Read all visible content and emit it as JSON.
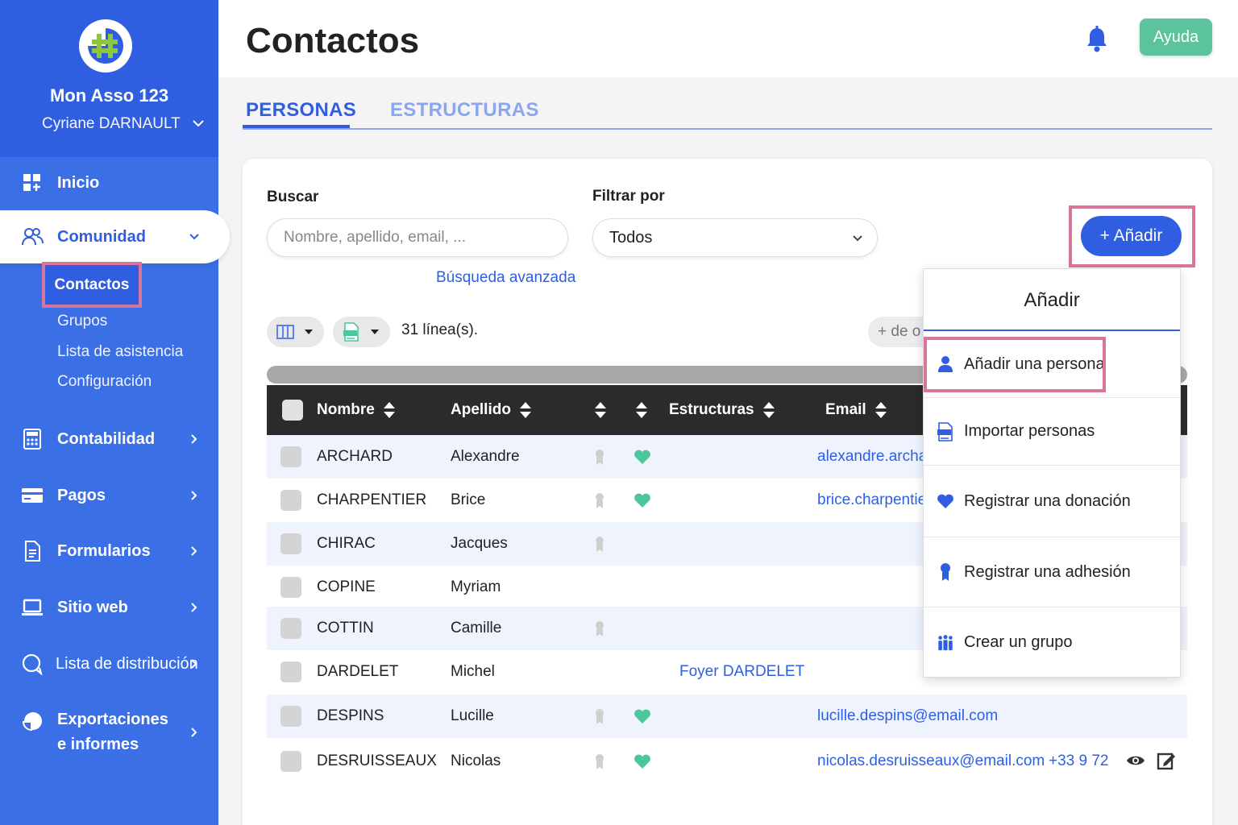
{
  "sidebar": {
    "org_name": "Mon Asso 123",
    "user_name": "Cyriane DARNAULT",
    "items": [
      {
        "label": "Inicio",
        "icon": "dashboard-icon"
      },
      {
        "label": "Comunidad",
        "icon": "community-icon"
      },
      {
        "label": "Contabilidad",
        "icon": "calculator-icon"
      },
      {
        "label": "Pagos",
        "icon": "credit-card-icon"
      },
      {
        "label": "Formularios",
        "icon": "form-icon"
      },
      {
        "label": "Sitio web",
        "icon": "laptop-icon"
      },
      {
        "label": "Lista de distribución",
        "icon": "chat-icon"
      },
      {
        "label": "Exportaciones e informes",
        "icon": "pie-chart-icon"
      }
    ],
    "sub_items": [
      "Contactos",
      "Grupos",
      "Lista de asistencia",
      "Configuración"
    ]
  },
  "header": {
    "title": "Contactos",
    "help_label": "Ayuda"
  },
  "tabs": [
    "PERSONAS",
    "ESTRUCTURAS"
  ],
  "filters": {
    "search_label": "Buscar",
    "search_placeholder": "Nombre, apellido, email, ...",
    "filter_label": "Filtrar por",
    "filter_value": "Todos",
    "advanced_search": "Búsqueda avanzada",
    "add_button": "+ Añadir"
  },
  "toolbar": {
    "lines_count": "31 línea(s).",
    "more_label": "+ de o"
  },
  "table": {
    "columns": [
      "Nombre",
      "Apellido",
      "",
      "",
      "Estructuras",
      "Email"
    ],
    "rows": [
      {
        "nombre": "ARCHARD",
        "apellido": "Alexandre",
        "membership": true,
        "donor": true,
        "estructura": "",
        "email": "alexandre.archard",
        "phone": ""
      },
      {
        "nombre": "CHARPENTIER",
        "apellido": "Brice",
        "membership": true,
        "donor": true,
        "estructura": "",
        "email": "brice.charpentier",
        "phone": ""
      },
      {
        "nombre": "CHIRAC",
        "apellido": "Jacques",
        "membership": true,
        "donor": false,
        "estructura": "",
        "email": "",
        "phone": ""
      },
      {
        "nombre": "COPINE",
        "apellido": "Myriam",
        "membership": false,
        "donor": false,
        "estructura": "",
        "email": "",
        "phone": ""
      },
      {
        "nombre": "COTTIN",
        "apellido": "Camille",
        "membership": true,
        "donor": false,
        "estructura": "",
        "email": "",
        "phone": ""
      },
      {
        "nombre": "DARDELET",
        "apellido": "Michel",
        "membership": false,
        "donor": false,
        "estructura": "Foyer DARDELET",
        "email": "",
        "phone": ""
      },
      {
        "nombre": "DESPINS",
        "apellido": "Lucille",
        "membership": true,
        "donor": true,
        "estructura": "",
        "email": "lucille.despins@email.com",
        "phone": ""
      },
      {
        "nombre": "DESRUISSEAUX",
        "apellido": "Nicolas",
        "membership": true,
        "donor": true,
        "estructura": "",
        "email": "nicolas.desruisseaux@email.com",
        "phone": "+33 9 72"
      }
    ]
  },
  "add_menu": {
    "title": "Añadir",
    "items": [
      {
        "label": "Añadir una persona",
        "icon": "person-icon"
      },
      {
        "label": "Importar personas",
        "icon": "spreadsheet-icon"
      },
      {
        "label": "Registrar una donación",
        "icon": "heart-icon"
      },
      {
        "label": "Registrar una adhesión",
        "icon": "ribbon-icon"
      },
      {
        "label": "Crear un grupo",
        "icon": "group-icon"
      }
    ]
  },
  "colors": {
    "primary": "#2f5fe0",
    "sidebar": "#3b6fe6",
    "help": "#5cc49c",
    "highlight": "#d9749c",
    "donor": "#4cc79a"
  }
}
